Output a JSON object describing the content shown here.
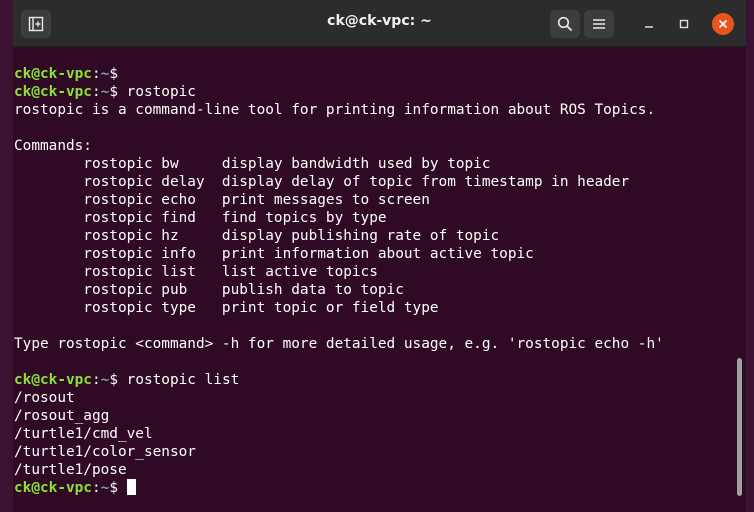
{
  "window": {
    "title": "ck@ck-vpc: ~"
  },
  "prompt": {
    "user": "ck@ck-vpc",
    "sep": ":",
    "path": "~",
    "dollar": "$ "
  },
  "terminal": {
    "lines": [
      {
        "type": "prompt",
        "command": ""
      },
      {
        "type": "prompt",
        "command": "rostopic"
      },
      {
        "type": "text",
        "text": "rostopic is a command-line tool for printing information about ROS Topics."
      },
      {
        "type": "text",
        "text": ""
      },
      {
        "type": "text",
        "text": "Commands:"
      },
      {
        "type": "text",
        "text": "        rostopic bw     display bandwidth used by topic"
      },
      {
        "type": "text",
        "text": "        rostopic delay  display delay of topic from timestamp in header"
      },
      {
        "type": "text",
        "text": "        rostopic echo   print messages to screen"
      },
      {
        "type": "text",
        "text": "        rostopic find   find topics by type"
      },
      {
        "type": "text",
        "text": "        rostopic hz     display publishing rate of topic"
      },
      {
        "type": "text",
        "text": "        rostopic info   print information about active topic"
      },
      {
        "type": "text",
        "text": "        rostopic list   list active topics"
      },
      {
        "type": "text",
        "text": "        rostopic pub    publish data to topic"
      },
      {
        "type": "text",
        "text": "        rostopic type   print topic or field type"
      },
      {
        "type": "text",
        "text": ""
      },
      {
        "type": "text",
        "text": "Type rostopic <command> -h for more detailed usage, e.g. 'rostopic echo -h'"
      },
      {
        "type": "text",
        "text": ""
      },
      {
        "type": "prompt",
        "command": "rostopic list"
      },
      {
        "type": "text",
        "text": "/rosout"
      },
      {
        "type": "text",
        "text": "/rosout_agg"
      },
      {
        "type": "text",
        "text": "/turtle1/cmd_vel"
      },
      {
        "type": "text",
        "text": "/turtle1/color_sensor"
      },
      {
        "type": "text",
        "text": "/turtle1/pose"
      },
      {
        "type": "prompt_cursor",
        "command": ""
      }
    ]
  },
  "icons": {
    "new_tab": "new-tab-icon",
    "search": "search-icon",
    "menu": "hamburger-menu-icon",
    "minimize": "minimize-icon",
    "maximize": "maximize-icon",
    "close": "close-icon"
  },
  "colors": {
    "background": "#300a24",
    "user": "#8ae234",
    "path": "#729fcf",
    "close": "#e95420"
  }
}
